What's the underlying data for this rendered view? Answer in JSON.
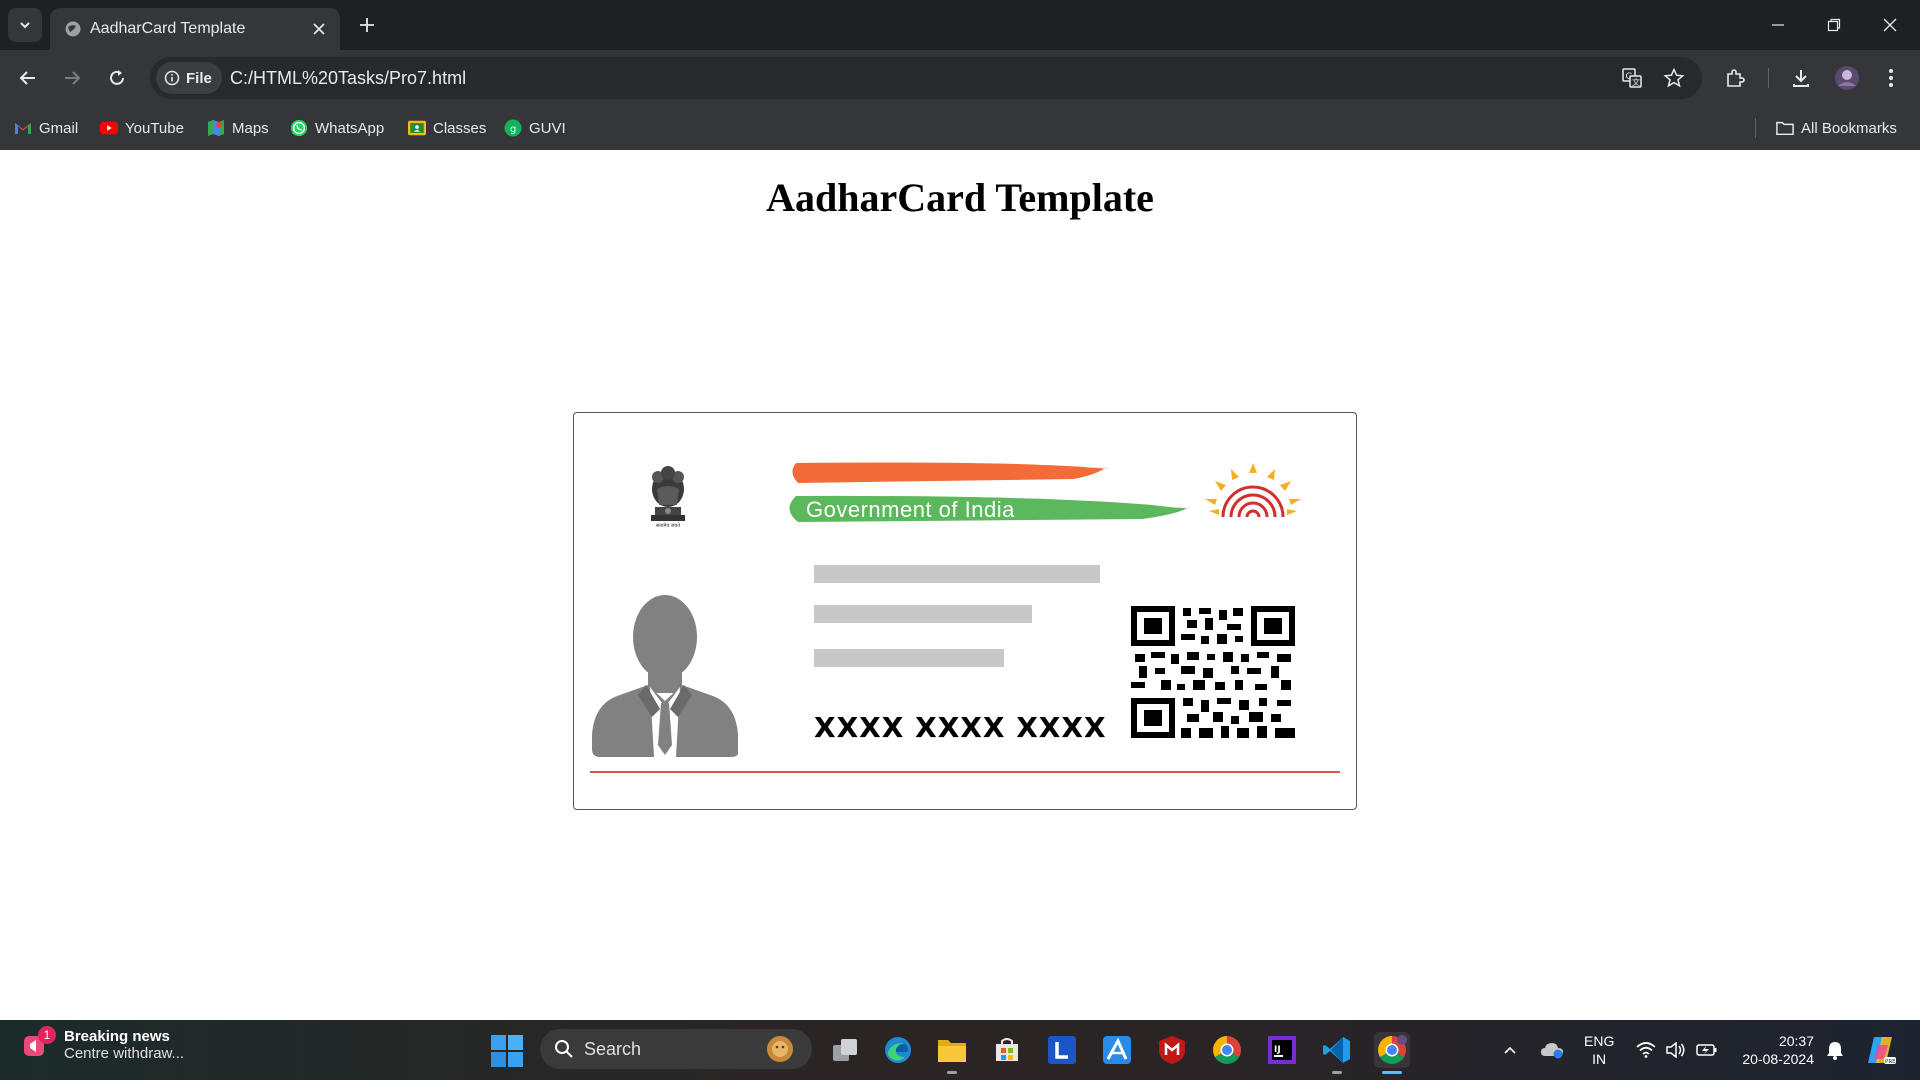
{
  "browser": {
    "tab": {
      "title": "AadharCard Template"
    },
    "address_bar": {
      "site_info_label": "File",
      "url": "C:/HTML%20Tasks/Pro7.html"
    },
    "bookmarks": [
      {
        "label": "Gmail",
        "icon": "gmail-icon"
      },
      {
        "label": "YouTube",
        "icon": "youtube-icon"
      },
      {
        "label": "Maps",
        "icon": "maps-icon"
      },
      {
        "label": "WhatsApp",
        "icon": "whatsapp-icon"
      },
      {
        "label": "Classes",
        "icon": "classroom-icon"
      },
      {
        "label": "GUVI",
        "icon": "guvi-icon"
      }
    ],
    "all_bookmarks_label": "All Bookmarks"
  },
  "page": {
    "title": "AadharCard Template",
    "card": {
      "government_label": "Government of India",
      "aadhaar_number": "XXXX XXXX XXXX",
      "emblem_caption": "सत्यमेव जयते",
      "accent_colors": {
        "saffron": "#f26b38",
        "green": "#5cb85c",
        "rule": "#d9534f",
        "placeholder": "#c8c8c8"
      }
    }
  },
  "taskbar": {
    "news": {
      "badge_count": "1",
      "title": "Breaking news",
      "subtitle": "Centre withdraw..."
    },
    "search_label": "Search",
    "apps": [
      "task-view",
      "edge",
      "file-explorer",
      "microsoft-store",
      "l-app",
      "pen-app",
      "mcafee",
      "chrome",
      "intellij",
      "vscode",
      "chrome-active"
    ],
    "language": {
      "line1": "ENG",
      "line2": "IN"
    },
    "time": "20:37",
    "date": "20-08-2024"
  }
}
